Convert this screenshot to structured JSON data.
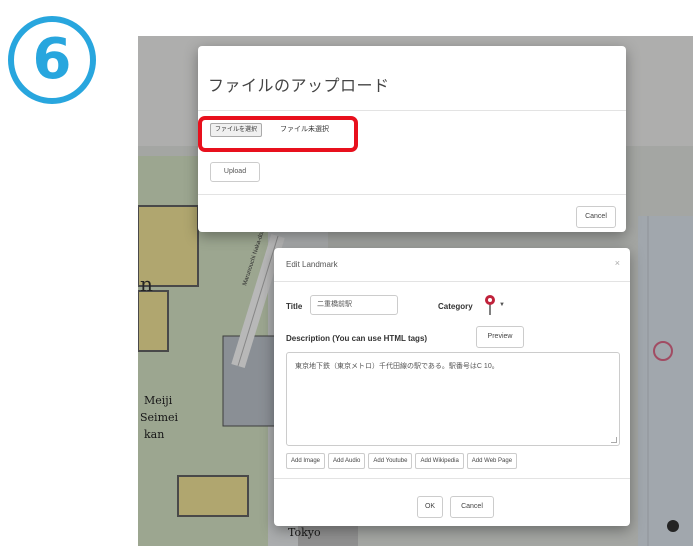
{
  "step_badge": {
    "number": "6",
    "color": "#28a6de"
  },
  "upload_dialog": {
    "title": "ファイルのアップロード",
    "choose_file_label": "ファイルを選択",
    "file_status": "ファイル未選択",
    "upload_label": "Upload",
    "cancel_label": "Cancel",
    "highlight_color": "#e8101d"
  },
  "edit_dialog": {
    "title": "Edit Landmark",
    "close_label": "×",
    "title_label": "Title",
    "title_value": "二重橋前駅",
    "category_label": "Category",
    "category_icon": "map-pin-icon",
    "description_label": "Description (You can use HTML tags)",
    "preview_label": "Preview",
    "description_value": "東京地下鉄（東京メトロ）千代田線の駅である。駅番号はC 10。",
    "add_buttons": [
      "Add Image",
      "Add Audio",
      "Add Youtube",
      "Add Wikipedia",
      "Add Web Page"
    ],
    "ok_label": "OK",
    "cancel_label": "Cancel"
  },
  "map": {
    "labels": [
      "Tokyo",
      "Meiji Seimei kan",
      "an",
      "Marunouchi Naka-dori"
    ]
  }
}
